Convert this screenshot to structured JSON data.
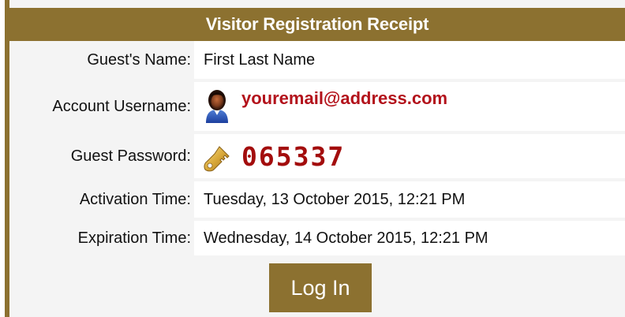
{
  "receipt": {
    "title": "Visitor Registration Receipt",
    "rows": {
      "guest_name": {
        "label": "Guest's Name:",
        "value": "First Last Name"
      },
      "account_username": {
        "label": "Account Username:",
        "value": "youremail@address.com",
        "icon": "user-avatar-icon"
      },
      "guest_password": {
        "label": "Guest Password:",
        "value": "065337",
        "icon": "key-icon"
      },
      "activation_time": {
        "label": "Activation Time:",
        "value": "Tuesday, 13 October 2015, 12:21 PM"
      },
      "expiration_time": {
        "label": "Expiration Time:",
        "value": "Wednesday, 14 October 2015, 12:21 PM"
      }
    },
    "login_button_label": "Log In"
  },
  "colors": {
    "header_bg": "#8c7130",
    "label_bg": "#f4f4f4",
    "value_bg": "#ffffff",
    "username_text": "#b3121b",
    "password_text": "#a30d0d"
  }
}
